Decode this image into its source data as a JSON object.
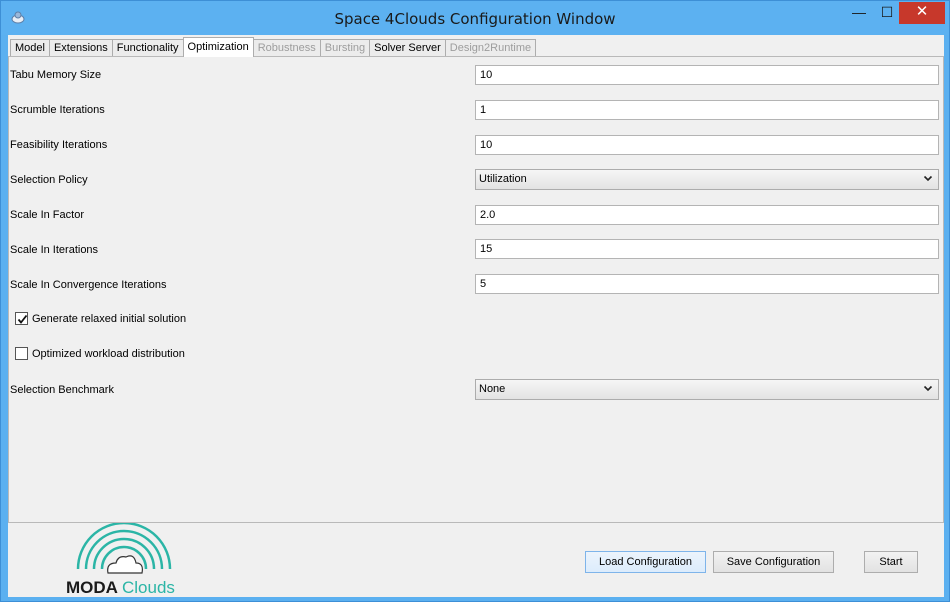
{
  "window": {
    "title": "Space 4Clouds Configuration Window",
    "min_glyph": "—",
    "max_glyph": "☐",
    "close_glyph": "✕"
  },
  "tabs": [
    {
      "label": "Model",
      "state": "normal"
    },
    {
      "label": "Extensions",
      "state": "normal"
    },
    {
      "label": "Functionality",
      "state": "normal"
    },
    {
      "label": "Optimization",
      "state": "active"
    },
    {
      "label": "Robustness",
      "state": "disabled"
    },
    {
      "label": "Bursting",
      "state": "disabled"
    },
    {
      "label": "Solver Server",
      "state": "normal"
    },
    {
      "label": "Design2Runtime",
      "state": "disabled"
    }
  ],
  "form": {
    "tabu_memory_size": {
      "label": "Tabu Memory Size",
      "value": "10"
    },
    "scrumble_iterations": {
      "label": "Scrumble Iterations",
      "value": "1"
    },
    "feasibility_iterations": {
      "label": "Feasibility Iterations",
      "value": "10"
    },
    "selection_policy": {
      "label": "Selection Policy",
      "value": "Utilization"
    },
    "scale_in_factor": {
      "label": "Scale In Factor",
      "value": "2.0"
    },
    "scale_in_iterations": {
      "label": "Scale In Iterations",
      "value": "15"
    },
    "scale_in_convergence_iterations": {
      "label": "Scale In Convergence Iterations",
      "value": "5"
    },
    "generate_relaxed": {
      "label": "Generate relaxed initial solution",
      "checked": true
    },
    "optimized_workload": {
      "label": "Optimized workload distribution",
      "checked": false
    },
    "selection_benchmark": {
      "label": "Selection Benchmark",
      "value": "None"
    }
  },
  "buttons": {
    "load": "Load Configuration",
    "save": "Save Configuration",
    "start": "Start"
  },
  "logo": {
    "part1": "MODA",
    "part2": "Clouds"
  },
  "colors": {
    "titlebar": "#5cb1f1",
    "close": "#c7382b",
    "logo_teal": "#2bb5a6"
  }
}
